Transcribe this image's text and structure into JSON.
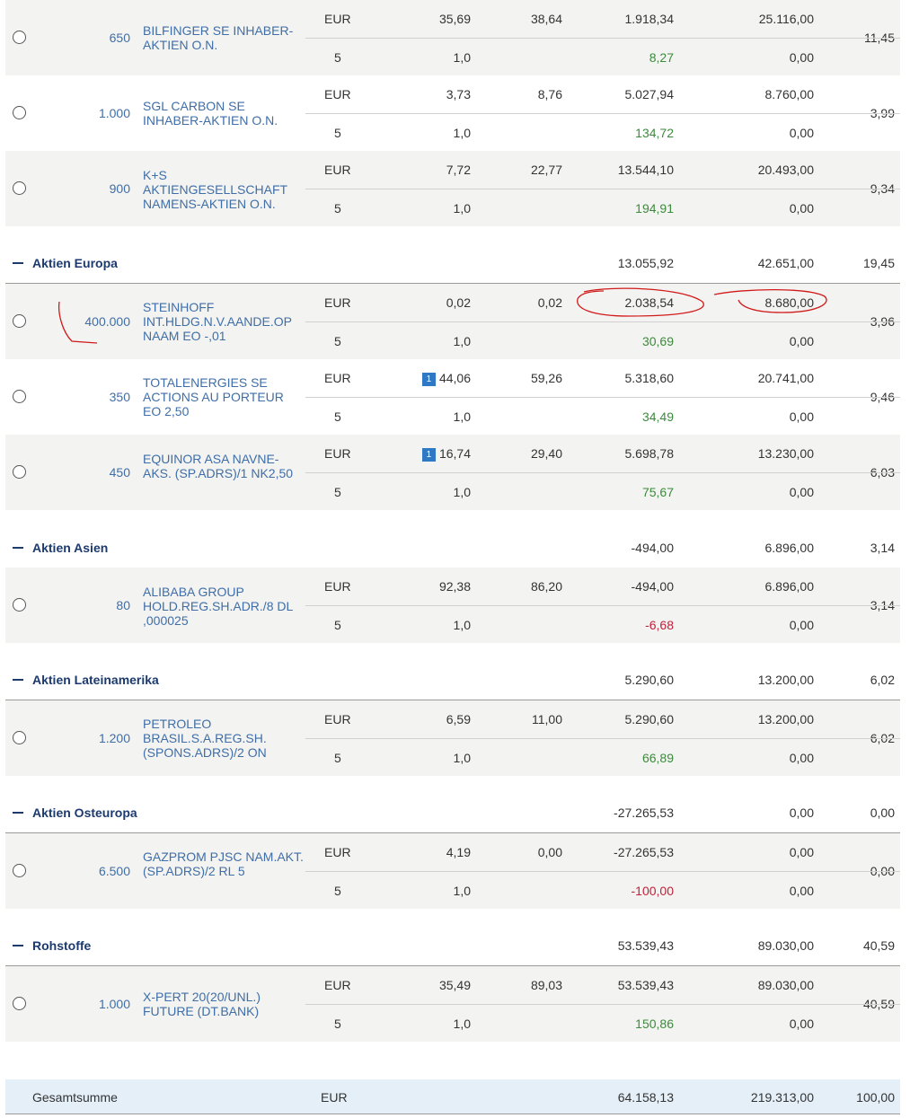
{
  "positions": {
    "bilfinger": {
      "qty": "650",
      "name": "BILFINGER SE INHABER-AKTIEN O.N.",
      "currency": "EUR",
      "col1": "35,69",
      "col2": "38,64",
      "col3": "1.918,34",
      "col4": "25.116,00",
      "pct": "11,45",
      "sub_a": "5",
      "sub_b": "1,0",
      "change": "8,27",
      "sub_val": "0,00"
    },
    "sgl": {
      "qty": "1.000",
      "name": "SGL CARBON SE INHABER-AKTIEN O.N.",
      "currency": "EUR",
      "col1": "3,73",
      "col2": "8,76",
      "col3": "5.027,94",
      "col4": "8.760,00",
      "pct": "3,99",
      "sub_a": "5",
      "sub_b": "1,0",
      "change": "134,72",
      "sub_val": "0,00"
    },
    "ks": {
      "qty": "900",
      "name": "K+S AKTIENGESELLSCHAFT NAMENS-AKTIEN O.N.",
      "currency": "EUR",
      "col1": "7,72",
      "col2": "22,77",
      "col3": "13.544,10",
      "col4": "20.493,00",
      "pct": "9,34",
      "sub_a": "5",
      "sub_b": "1,0",
      "change": "194,91",
      "sub_val": "0,00"
    },
    "steinhoff": {
      "qty": "400.000",
      "name": "STEINHOFF INT.HLDG.N.V.AANDE.OP NAAM EO -,01",
      "currency": "EUR",
      "col1": "0,02",
      "col2": "0,02",
      "col3": "2.038,54",
      "col4": "8.680,00",
      "pct": "3,96",
      "sub_a": "5",
      "sub_b": "1,0",
      "change": "30,69",
      "sub_val": "0,00"
    },
    "total": {
      "qty": "350",
      "name": "TOTALENERGIES SE ACTIONS AU PORTEUR EO 2,50",
      "currency": "EUR",
      "badge": "1",
      "col1": "44,06",
      "col2": "59,26",
      "col3": "5.318,60",
      "col4": "20.741,00",
      "pct": "9,46",
      "sub_a": "5",
      "sub_b": "1,0",
      "change": "34,49",
      "sub_val": "0,00"
    },
    "equinor": {
      "qty": "450",
      "name": "EQUINOR ASA NAVNE-AKS. (SP.ADRS)/1 NK2,50",
      "currency": "EUR",
      "badge": "1",
      "col1": "16,74",
      "col2": "29,40",
      "col3": "5.698,78",
      "col4": "13.230,00",
      "pct": "6,03",
      "sub_a": "5",
      "sub_b": "1,0",
      "change": "75,67",
      "sub_val": "0,00"
    },
    "alibaba": {
      "qty": "80",
      "name": "ALIBABA GROUP HOLD.REG.SH.ADR./8 DL ,000025",
      "currency": "EUR",
      "col1": "92,38",
      "col2": "86,20",
      "col3": "-494,00",
      "col4": "6.896,00",
      "pct": "3,14",
      "sub_a": "5",
      "sub_b": "1,0",
      "change": "-6,68",
      "sub_val": "0,00"
    },
    "petroleo": {
      "qty": "1.200",
      "name": "PETROLEO BRASIL.S.A.REG.SH. (SPONS.ADRS)/2 ON",
      "currency": "EUR",
      "col1": "6,59",
      "col2": "11,00",
      "col3": "5.290,60",
      "col4": "13.200,00",
      "pct": "6,02",
      "sub_a": "5",
      "sub_b": "1,0",
      "change": "66,89",
      "sub_val": "0,00"
    },
    "gazprom": {
      "qty": "6.500",
      "name": "GAZPROM PJSC NAM.AKT.(SP.ADRS)/2 RL 5",
      "currency": "EUR",
      "col1": "4,19",
      "col2": "0,00",
      "col3": "-27.265,53",
      "col4": "0,00",
      "pct": "0,00",
      "sub_a": "5",
      "sub_b": "1,0",
      "change": "-100,00",
      "sub_val": "0,00"
    },
    "xpert": {
      "qty": "1.000",
      "name": "X-PERT 20(20/UNL.) FUTURE (DT.BANK)",
      "currency": "EUR",
      "col1": "35,49",
      "col2": "89,03",
      "col3": "53.539,43",
      "col4": "89.030,00",
      "pct": "40,59",
      "sub_a": "5",
      "sub_b": "1,0",
      "change": "150,86",
      "sub_val": "0,00"
    }
  },
  "categories": {
    "europa": {
      "label": "Aktien Europa",
      "col3": "13.055,92",
      "col4": "42.651,00",
      "pct": "19,45"
    },
    "asien": {
      "label": "Aktien Asien",
      "col3": "-494,00",
      "col4": "6.896,00",
      "pct": "3,14"
    },
    "latam": {
      "label": "Aktien Lateinamerika",
      "col3": "5.290,60",
      "col4": "13.200,00",
      "pct": "6,02"
    },
    "osteuropa": {
      "label": "Aktien Osteuropa",
      "col3": "-27.265,53",
      "col4": "0,00",
      "pct": "0,00"
    },
    "rohstoffe": {
      "label": "Rohstoffe",
      "col3": "53.539,43",
      "col4": "89.030,00",
      "pct": "40,59"
    }
  },
  "total": {
    "label": "Gesamtsumme",
    "currency": "EUR",
    "col3": "64.158,13",
    "col4": "219.313,00",
    "pct": "100,00"
  },
  "colors": {
    "link": "#3f6ea8",
    "gain": "#3d8a3d",
    "loss": "#c0213a",
    "header": "#1c3a6e",
    "annotation": "#d11a1a"
  }
}
